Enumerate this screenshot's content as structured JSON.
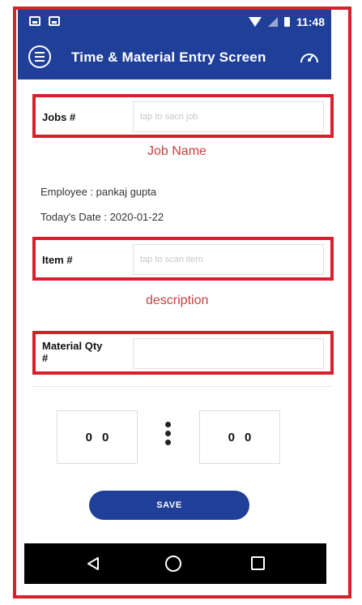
{
  "status_bar": {
    "time": "11:48"
  },
  "app_bar": {
    "title": "Time & Material Entry Screen"
  },
  "job": {
    "label": "Jobs #",
    "placeholder": "tap to sacn job",
    "name": "Job Name"
  },
  "employee": {
    "text": "Employee : pankaj gupta"
  },
  "date": {
    "text": "Today's Date : 2020-01-22"
  },
  "item": {
    "label": "Item #",
    "placeholder": "tap to scan item",
    "description": "description"
  },
  "material": {
    "label_line1": "Material Qty",
    "label_line2": "#",
    "value": ""
  },
  "time": {
    "hours": [
      "0",
      "0"
    ],
    "minutes": [
      "0",
      "0"
    ]
  },
  "save": {
    "label": "SAVE"
  },
  "colors": {
    "brand": "#1f3f99",
    "highlight": "#d6202c",
    "accent_text": "#c94040"
  },
  "icons": [
    "menu-icon",
    "speedometer-icon",
    "wifi-icon",
    "signal-icon",
    "battery-icon",
    "back-icon",
    "home-icon",
    "recent-apps-icon"
  ]
}
